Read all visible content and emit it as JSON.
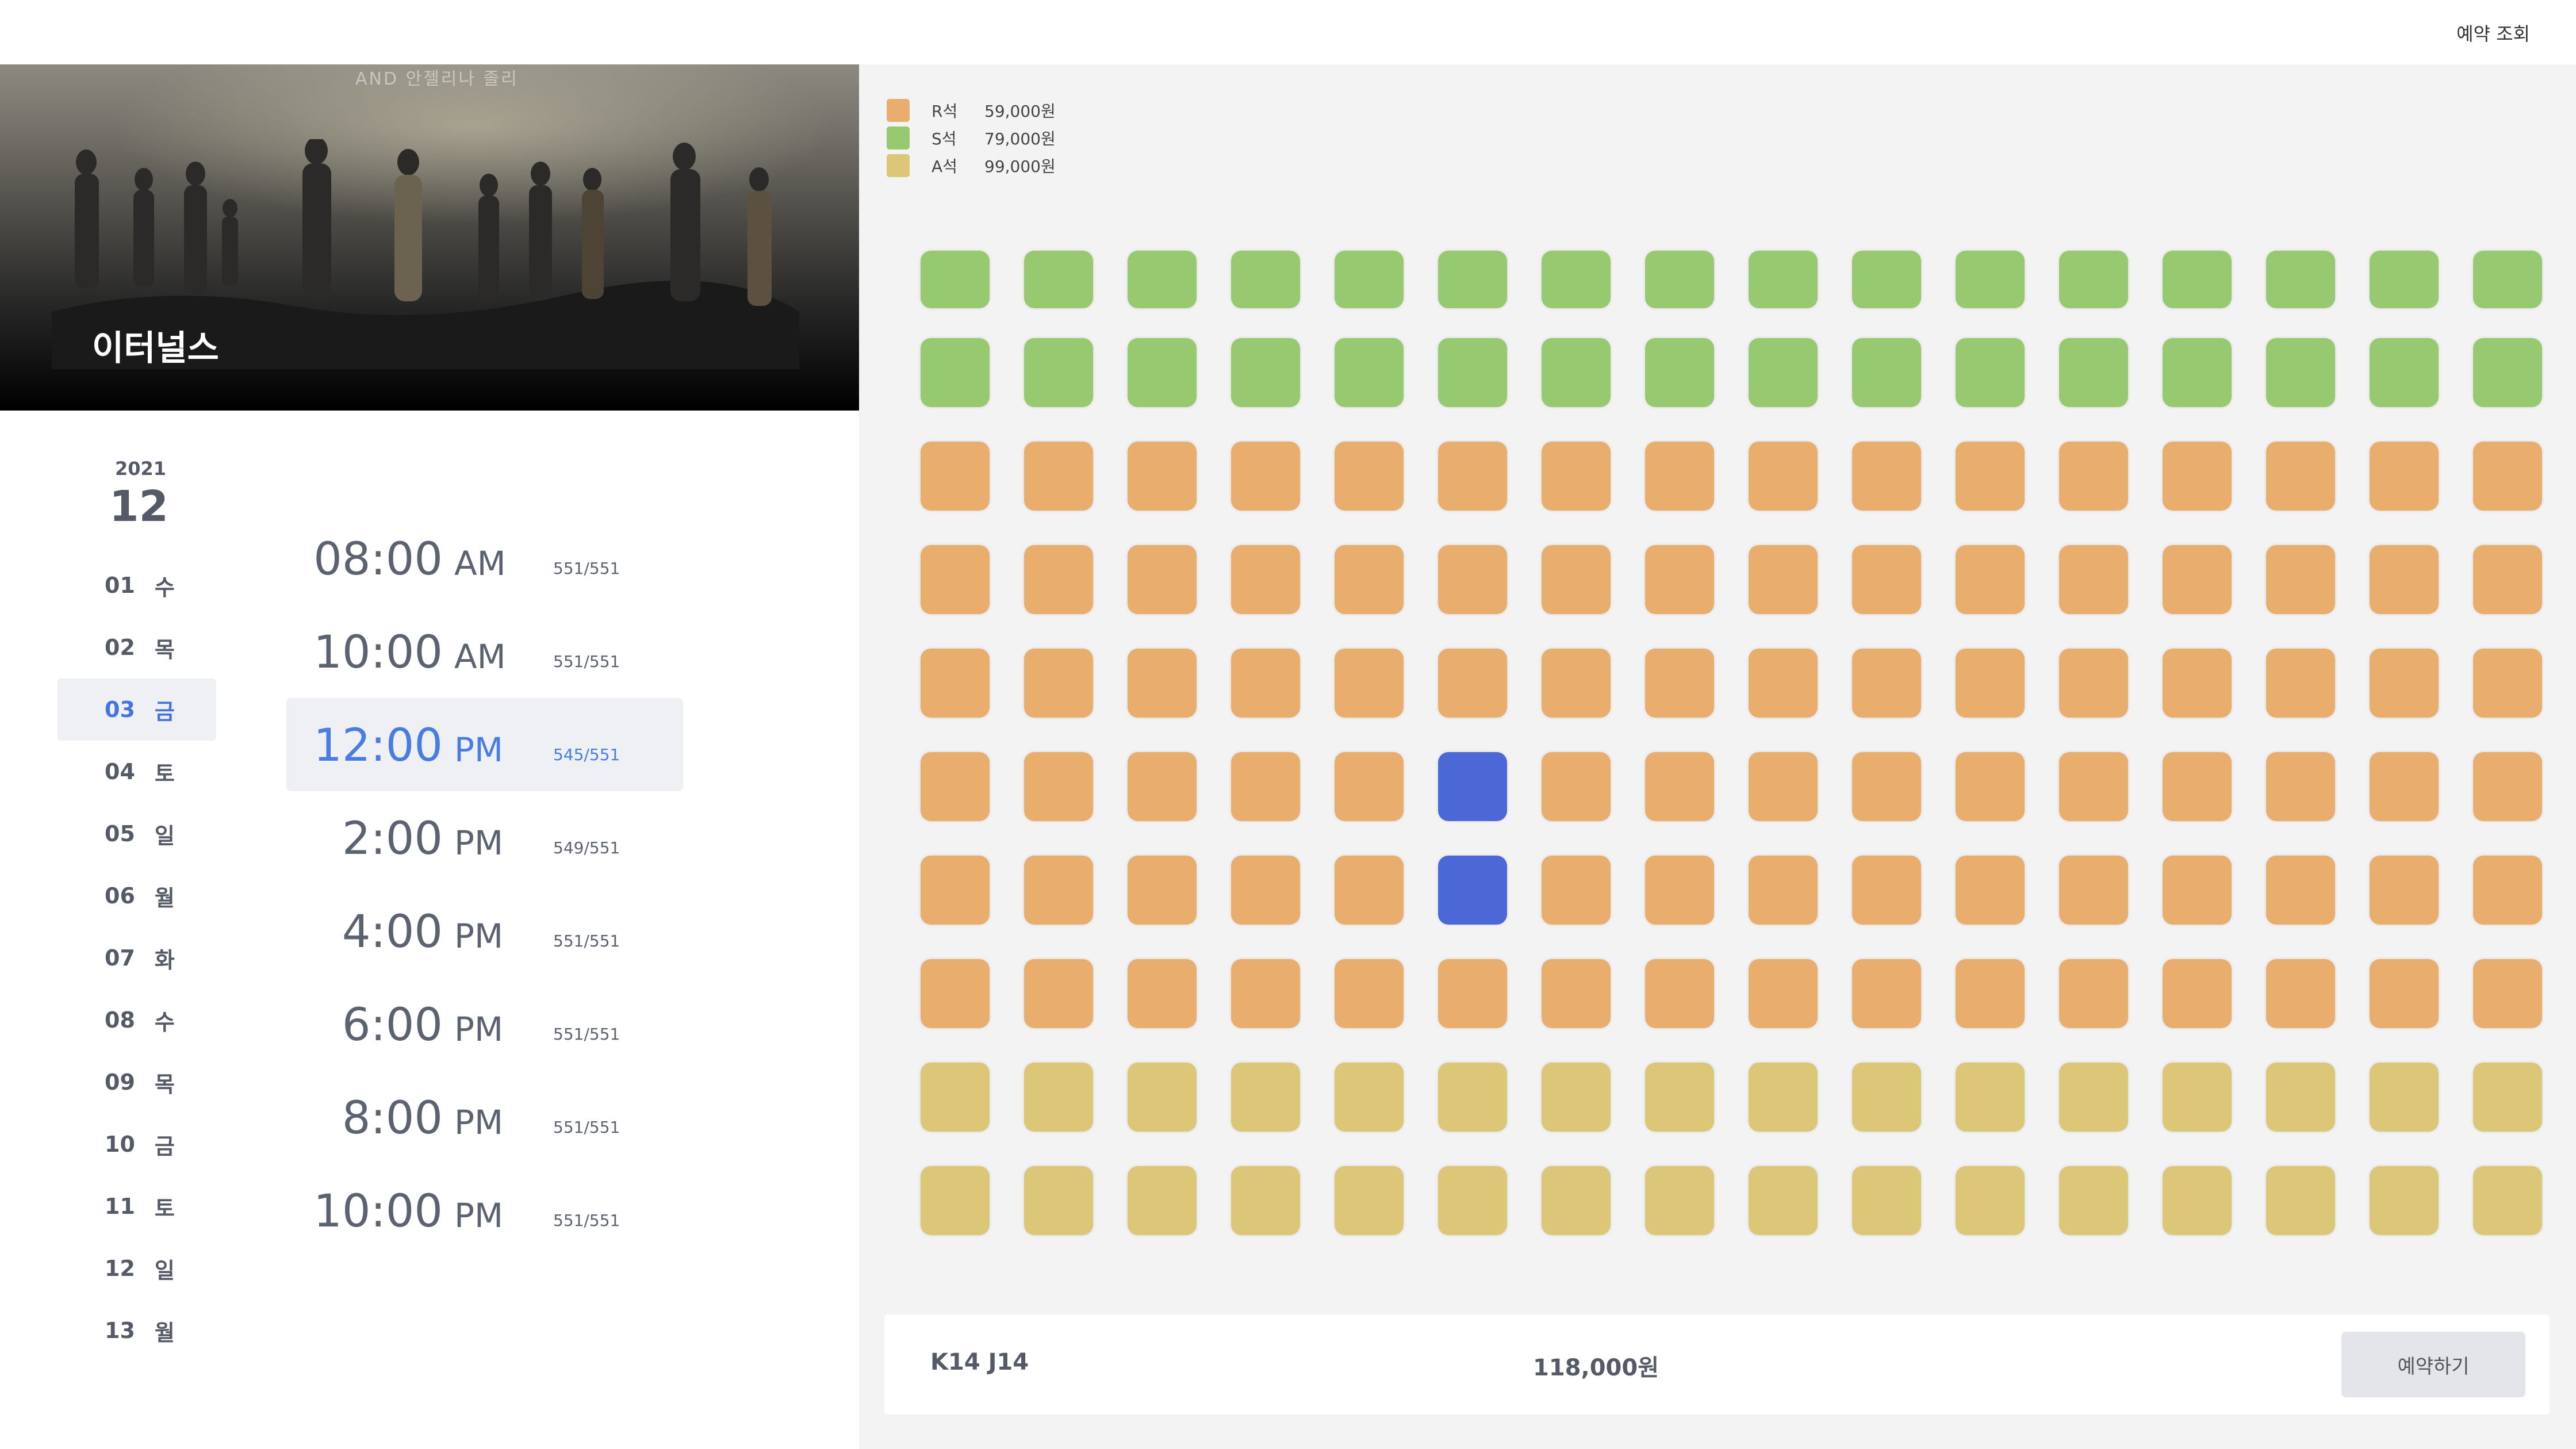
{
  "header": {
    "lookup_label": "예약 조회"
  },
  "movie": {
    "title": "이터널스",
    "poster_credit": "AND 안젤리나 졸리"
  },
  "calendar": {
    "year": "2021",
    "month": "12",
    "dates": [
      {
        "num": "01",
        "day": "수"
      },
      {
        "num": "02",
        "day": "목"
      },
      {
        "num": "03",
        "day": "금",
        "selected": true
      },
      {
        "num": "04",
        "day": "토"
      },
      {
        "num": "05",
        "day": "일"
      },
      {
        "num": "06",
        "day": "월"
      },
      {
        "num": "07",
        "day": "화"
      },
      {
        "num": "08",
        "day": "수"
      },
      {
        "num": "09",
        "day": "목"
      },
      {
        "num": "10",
        "day": "금"
      },
      {
        "num": "11",
        "day": "토"
      },
      {
        "num": "12",
        "day": "일"
      },
      {
        "num": "13",
        "day": "월"
      }
    ]
  },
  "showtimes": [
    {
      "time": "08:00",
      "ampm": "AM",
      "seats": "551/551"
    },
    {
      "time": "10:00",
      "ampm": "AM",
      "seats": "551/551"
    },
    {
      "time": "12:00",
      "ampm": "PM",
      "seats": "545/551",
      "selected": true
    },
    {
      "time": "2:00",
      "ampm": "PM",
      "seats": "549/551"
    },
    {
      "time": "4:00",
      "ampm": "PM",
      "seats": "551/551"
    },
    {
      "time": "6:00",
      "ampm": "PM",
      "seats": "551/551"
    },
    {
      "time": "8:00",
      "ampm": "PM",
      "seats": "551/551"
    },
    {
      "time": "10:00",
      "ampm": "PM",
      "seats": "551/551"
    }
  ],
  "legend": [
    {
      "grade": "R석",
      "price": "59,000원",
      "color": "#e9ad6e"
    },
    {
      "grade": "S석",
      "price": "79,000원",
      "color": "#97c970"
    },
    {
      "grade": "A석",
      "price": "99,000원",
      "color": "#dcc778"
    }
  ],
  "seat_map": {
    "columns": 16,
    "rows": [
      "S",
      "S",
      "R",
      "R",
      "R",
      "R",
      "R",
      "R",
      "A",
      "A"
    ],
    "selected_seats": [
      [
        5,
        5
      ],
      [
        6,
        5
      ]
    ],
    "selected_color": "#4b68d6"
  },
  "summary": {
    "selected_seats": "K14 J14",
    "total_price": "118,000원",
    "reserve_label": "예약하기"
  }
}
